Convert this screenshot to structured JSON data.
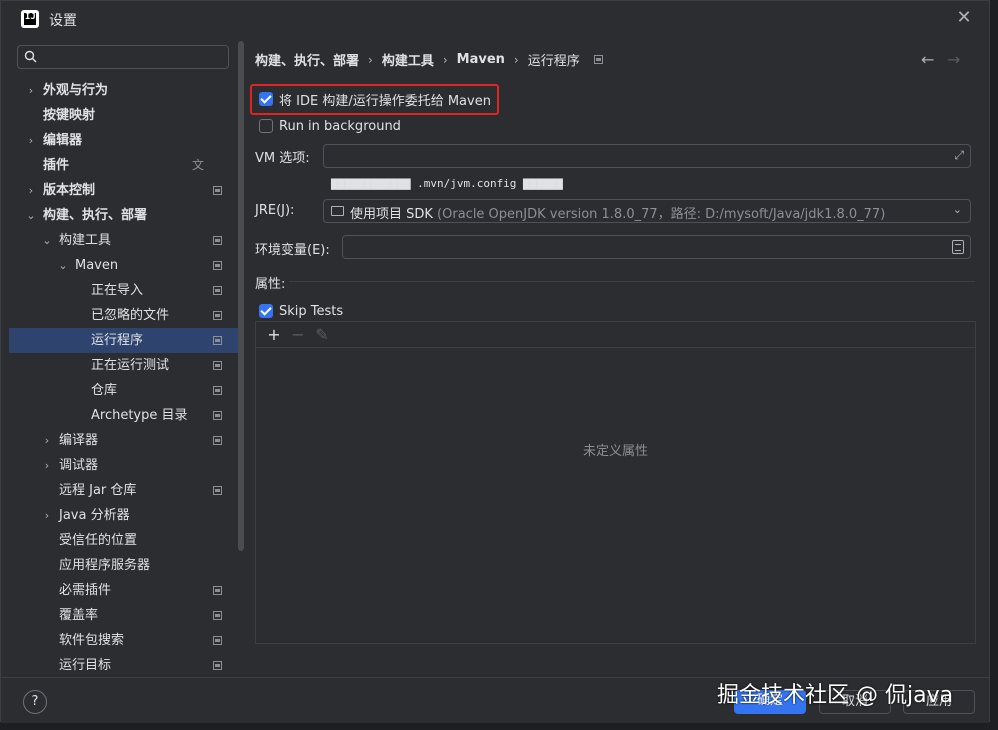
{
  "window": {
    "title": "设置",
    "logo_text": "IJ"
  },
  "sidebar": {
    "search_placeholder": "",
    "items": [
      {
        "label": "外观与行为",
        "level": 0,
        "expand": "collapsed",
        "bold": true,
        "proj": false
      },
      {
        "label": "按键映射",
        "level": 0,
        "expand": "none",
        "bold": true,
        "proj": false
      },
      {
        "label": "编辑器",
        "level": 0,
        "expand": "collapsed",
        "bold": true,
        "proj": false
      },
      {
        "label": "插件",
        "level": 0,
        "expand": "none",
        "bold": true,
        "proj": false,
        "lang": true
      },
      {
        "label": "版本控制",
        "level": 0,
        "expand": "collapsed",
        "bold": true,
        "proj": true
      },
      {
        "label": "构建、执行、部署",
        "level": 0,
        "expand": "expanded",
        "bold": true,
        "proj": false
      },
      {
        "label": "构建工具",
        "level": 1,
        "expand": "expanded",
        "bold": false,
        "proj": true
      },
      {
        "label": "Maven",
        "level": 2,
        "expand": "expanded",
        "bold": false,
        "proj": true
      },
      {
        "label": "正在导入",
        "level": 3,
        "expand": "none",
        "bold": false,
        "proj": true
      },
      {
        "label": "已忽略的文件",
        "level": 3,
        "expand": "none",
        "bold": false,
        "proj": true
      },
      {
        "label": "运行程序",
        "level": 3,
        "expand": "none",
        "bold": false,
        "proj": true,
        "selected": true
      },
      {
        "label": "正在运行测试",
        "level": 3,
        "expand": "none",
        "bold": false,
        "proj": true
      },
      {
        "label": "仓库",
        "level": 3,
        "expand": "none",
        "bold": false,
        "proj": true
      },
      {
        "label": "Archetype 目录",
        "level": 3,
        "expand": "none",
        "bold": false,
        "proj": true
      },
      {
        "label": "编译器",
        "level": 1,
        "expand": "collapsed",
        "bold": false,
        "proj": true
      },
      {
        "label": "调试器",
        "level": 1,
        "expand": "collapsed",
        "bold": false,
        "proj": false
      },
      {
        "label": "远程 Jar 仓库",
        "level": 1,
        "expand": "none",
        "bold": false,
        "proj": true
      },
      {
        "label": "Java 分析器",
        "level": 1,
        "expand": "collapsed",
        "bold": false,
        "proj": false
      },
      {
        "label": "受信任的位置",
        "level": 1,
        "expand": "none",
        "bold": false,
        "proj": false
      },
      {
        "label": "应用程序服务器",
        "level": 1,
        "expand": "none",
        "bold": false,
        "proj": false
      },
      {
        "label": "必需插件",
        "level": 1,
        "expand": "none",
        "bold": false,
        "proj": true
      },
      {
        "label": "覆盖率",
        "level": 1,
        "expand": "none",
        "bold": false,
        "proj": true
      },
      {
        "label": "软件包搜索",
        "level": 1,
        "expand": "none",
        "bold": false,
        "proj": true
      },
      {
        "label": "运行目标",
        "level": 1,
        "expand": "none",
        "bold": false,
        "proj": true
      }
    ]
  },
  "breadcrumb": {
    "items": [
      "构建、执行、部署",
      "构建工具",
      "Maven"
    ],
    "current": "运行程序",
    "sep": "›",
    "back": "←",
    "forward": "→"
  },
  "runner": {
    "delegate_label": "将 IDE 构建/运行操作委托给 Maven",
    "delegate_checked": true,
    "background_label": "Run in background",
    "background_checked": false,
    "vm_label": "VM 选项:",
    "vm_value": "",
    "vm_hint": "▇▇▇▇▇▇▇▇▇▇▇▇ .mvn/jvm.config ▇▇▇▇▇▇",
    "jre_label": "JRE(J):",
    "jre_value": "使用项目 SDK",
    "jre_detail": " (Oracle OpenJDK version 1.8.0_77，路径: D:/mysoft/Java/jdk1.8.0_77)",
    "env_label": "环境变量(E):",
    "env_value": "",
    "props_label": "属性:",
    "skip_tests_label": "Skip Tests",
    "skip_tests_checked": true,
    "empty_props": "未定义属性"
  },
  "footer": {
    "help": "?",
    "ok": "确定",
    "cancel": "取消",
    "apply": "应用",
    "watermark": "掘金技术社区 @ 侃java"
  }
}
